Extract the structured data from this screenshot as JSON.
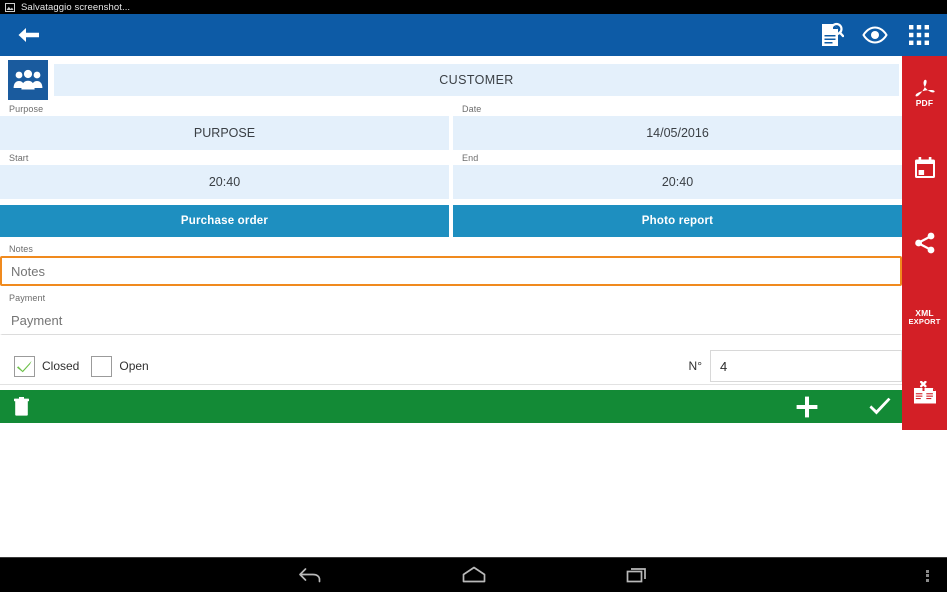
{
  "status_bar": {
    "icon": "image-saved-icon",
    "text": "Salvataggio screenshot..."
  },
  "app_bar": {
    "back_icon": "back-arrow-icon",
    "background": "#0d5ba6",
    "actions": [
      {
        "icon": "document-search-icon",
        "name": "document-search"
      },
      {
        "icon": "eye-icon",
        "name": "preview"
      },
      {
        "icon": "apps-grid-icon",
        "name": "apps-grid"
      }
    ]
  },
  "form": {
    "customer": {
      "icon": "customers-group-icon",
      "value": "CUSTOMER"
    },
    "purpose": {
      "label": "Purpose",
      "value": "PURPOSE"
    },
    "date": {
      "label": "Date",
      "value": "14/05/2016"
    },
    "start": {
      "label": "Start",
      "value": "20:40"
    },
    "end": {
      "label": "End",
      "value": "20:40"
    },
    "buttons": {
      "purchase_order": "Purchase order",
      "photo_report": "Photo report",
      "color": "#1e8fc0"
    },
    "notes": {
      "label": "Notes",
      "placeholder": "Notes",
      "value": "",
      "focused": true,
      "focus_color": "#f08a1e"
    },
    "payment": {
      "label": "Payment",
      "placeholder": "Payment",
      "value": ""
    },
    "closed": {
      "label": "Closed",
      "checked": true,
      "check_color": "#6cc049"
    },
    "open": {
      "label": "Open",
      "checked": false
    },
    "number": {
      "label": "N°",
      "value": "4"
    }
  },
  "action_bar": {
    "color": "#138a36",
    "delete_icon": "trash-icon",
    "add_icon": "plus-icon",
    "confirm_icon": "check-icon"
  },
  "side_rail": {
    "color": "#d31f26",
    "items": [
      {
        "icon": "pdf-icon",
        "label": "PDF",
        "name": "pdf-export"
      },
      {
        "icon": "calendar-icon",
        "label": "",
        "name": "calendar"
      },
      {
        "icon": "share-icon",
        "label": "",
        "name": "share"
      },
      {
        "icon": "xml-export-icon",
        "label": "XML",
        "label2": "EXPORT",
        "name": "xml-export"
      },
      {
        "icon": "delete-documents-icon",
        "label": "",
        "name": "delete-documents"
      }
    ]
  },
  "nav_bar": {
    "back": "nav-back-icon",
    "home": "nav-home-icon",
    "recents": "nav-recents-icon",
    "overflow": "nav-overflow-icon"
  }
}
